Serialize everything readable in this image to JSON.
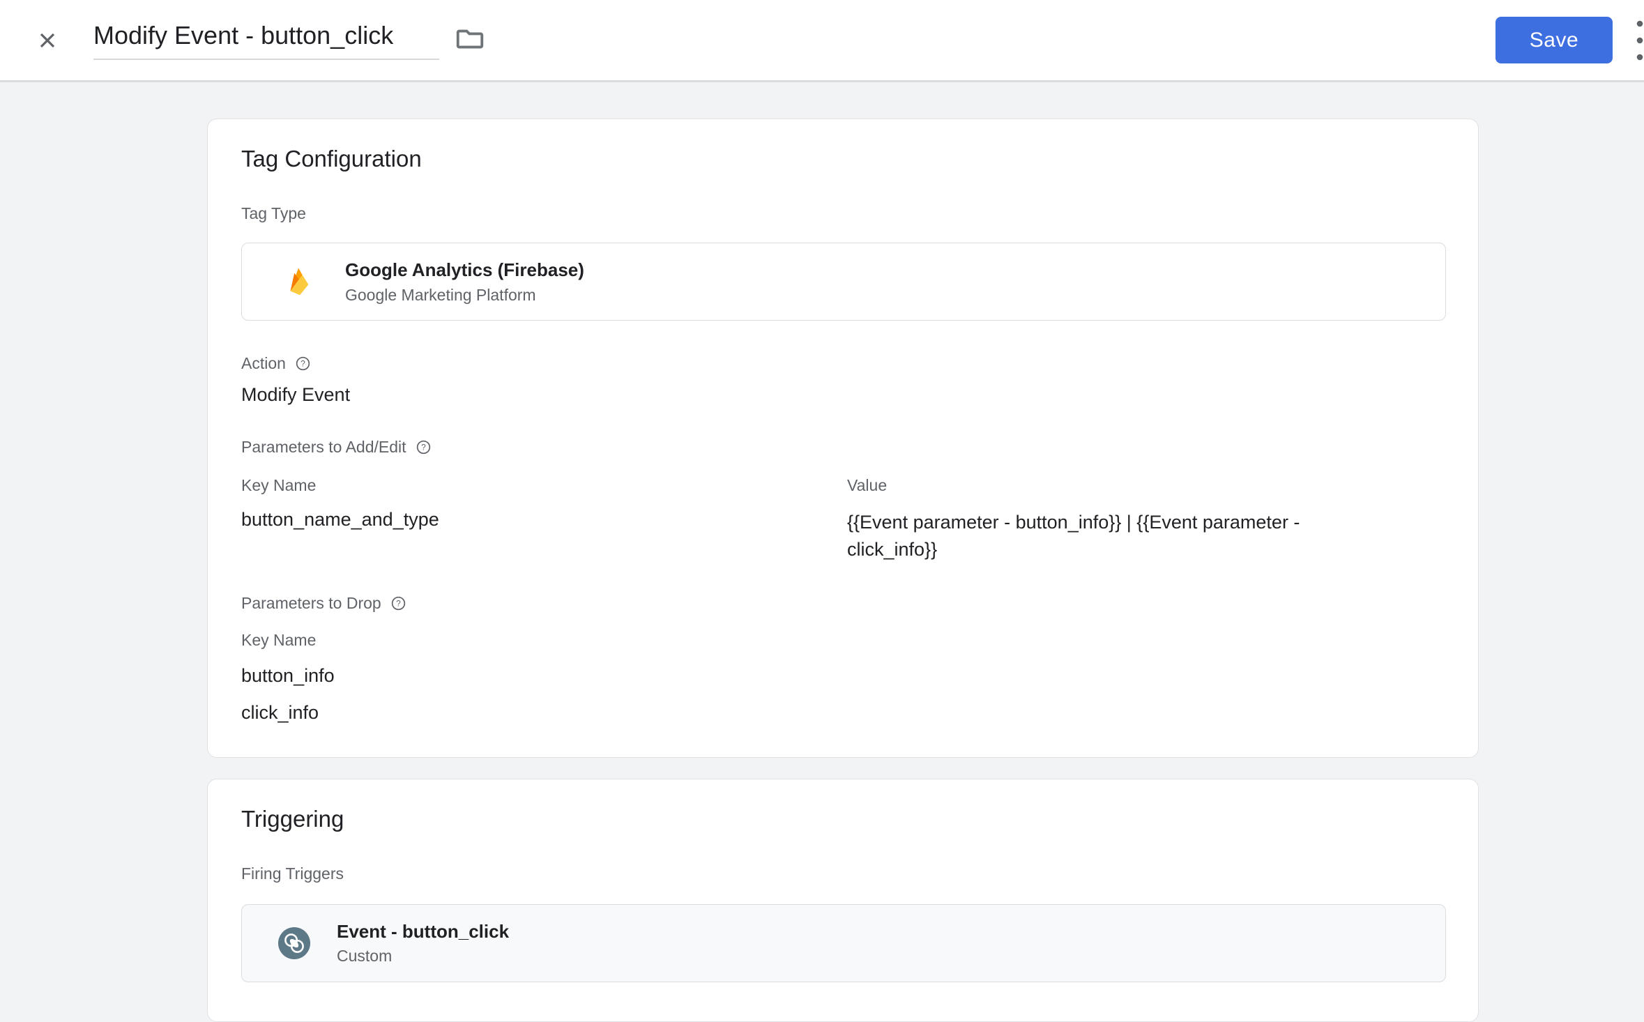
{
  "header": {
    "title": "Modify Event - button_click",
    "save_label": "Save"
  },
  "tag_configuration": {
    "heading": "Tag Configuration",
    "tag_type_label": "Tag Type",
    "tag_type": {
      "name": "Google Analytics (Firebase)",
      "subtitle": "Google Marketing Platform"
    },
    "action_label": "Action",
    "action_value": "Modify Event",
    "params_add_edit": {
      "label": "Parameters to Add/Edit",
      "key_header": "Key Name",
      "value_header": "Value",
      "rows": [
        {
          "key": "button_name_and_type",
          "value": "{{Event parameter - button_info}} | {{Event parameter - click_info}}"
        }
      ]
    },
    "params_drop": {
      "label": "Parameters to Drop",
      "key_header": "Key Name",
      "keys": [
        "button_info",
        "click_info"
      ]
    }
  },
  "triggering": {
    "heading": "Triggering",
    "firing_triggers_label": "Firing Triggers",
    "triggers": [
      {
        "name": "Event - button_click",
        "type": "Custom"
      }
    ]
  },
  "icons": {
    "close": "close-icon",
    "folder": "folder-icon",
    "help": "help-icon",
    "kebab": "kebab-menu-icon",
    "tag_type": "firebase-icon",
    "trigger": "custom-trigger-icon"
  },
  "colors": {
    "accent_blue": "#3e6fe1",
    "page_background": "#f1f3f4",
    "card_border": "#dfe1e5",
    "label_gray": "#5f6368",
    "text_dark": "#202124",
    "trigger_icon_slate": "#5d7886",
    "firebase_amber": "#FFA000",
    "firebase_orange": "#F57C00",
    "firebase_yellow": "#FCCA3F"
  }
}
